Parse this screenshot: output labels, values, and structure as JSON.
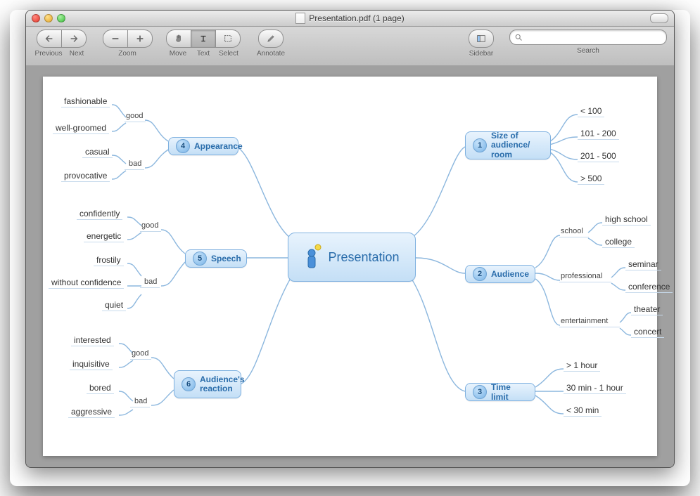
{
  "window": {
    "title": "Presentation.pdf (1 page)"
  },
  "toolbar": {
    "previous": "Previous",
    "next": "Next",
    "zoom": "Zoom",
    "move": "Move",
    "text": "Text",
    "select": "Select",
    "annotate": "Annotate",
    "sidebar": "Sidebar",
    "search": "Search",
    "search_placeholder": ""
  },
  "mindmap": {
    "center": {
      "title": "Presentation"
    },
    "right": [
      {
        "num": "1",
        "title": "Size of audience/\nroom",
        "children": [
          {
            "label": "< 100"
          },
          {
            "label": "101 - 200"
          },
          {
            "label": "201 - 500"
          },
          {
            "label": "> 500"
          }
        ]
      },
      {
        "num": "2",
        "title": "Audience",
        "children": [
          {
            "label": "school",
            "children": [
              {
                "label": "high school"
              },
              {
                "label": "college"
              }
            ]
          },
          {
            "label": "professional",
            "children": [
              {
                "label": "seminar"
              },
              {
                "label": "conference"
              }
            ]
          },
          {
            "label": "entertainment",
            "children": [
              {
                "label": "theater"
              },
              {
                "label": "concert"
              }
            ]
          }
        ]
      },
      {
        "num": "3",
        "title": "Time limit",
        "children": [
          {
            "label": "> 1 hour"
          },
          {
            "label": "30 min - 1 hour"
          },
          {
            "label": "< 30 min"
          }
        ]
      }
    ],
    "left": [
      {
        "num": "4",
        "title": "Appearance",
        "children": [
          {
            "label": "good",
            "children": [
              {
                "label": "fashionable"
              },
              {
                "label": "well-groomed"
              }
            ]
          },
          {
            "label": "bad",
            "children": [
              {
                "label": "casual"
              },
              {
                "label": "provocative"
              }
            ]
          }
        ]
      },
      {
        "num": "5",
        "title": "Speech",
        "children": [
          {
            "label": "good",
            "children": [
              {
                "label": "confidently"
              },
              {
                "label": "energetic"
              }
            ]
          },
          {
            "label": "bad",
            "children": [
              {
                "label": "frostily"
              },
              {
                "label": "without confidence"
              },
              {
                "label": "quiet"
              }
            ]
          }
        ]
      },
      {
        "num": "6",
        "title": "Audience's\nreaction",
        "children": [
          {
            "label": "good",
            "children": [
              {
                "label": "interested"
              },
              {
                "label": "inquisitive"
              }
            ]
          },
          {
            "label": "bad",
            "children": [
              {
                "label": "bored"
              },
              {
                "label": "aggressive"
              }
            ]
          }
        ]
      }
    ]
  }
}
